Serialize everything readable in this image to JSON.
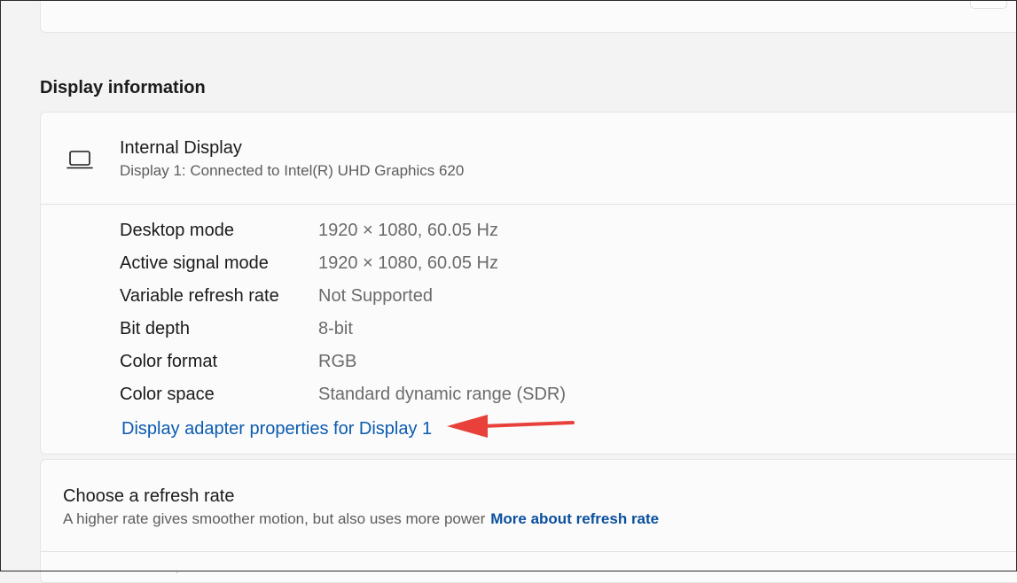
{
  "section": {
    "title": "Display information"
  },
  "display": {
    "icon": "laptop-icon",
    "name": "Internal Display",
    "subtitle": "Display 1: Connected to Intel(R) UHD Graphics 620",
    "info": [
      {
        "label": "Desktop mode",
        "value": "1920 × 1080, 60.05 Hz"
      },
      {
        "label": "Active signal mode",
        "value": "1920 × 1080, 60.05 Hz"
      },
      {
        "label": "Variable refresh rate",
        "value": "Not Supported"
      },
      {
        "label": "Bit depth",
        "value": "8-bit"
      },
      {
        "label": "Color format",
        "value": "RGB"
      },
      {
        "label": "Color space",
        "value": "Standard dynamic range (SDR)"
      }
    ],
    "adapter_link": "Display adapter properties for Display 1"
  },
  "refresh": {
    "title": "Choose a refresh rate",
    "description": "A higher rate gives smoother motion, but also uses more power",
    "link": "More about refresh rate"
  },
  "colors": {
    "accent_link": "#0a5bb0",
    "annotation_arrow": "#e8403a",
    "card_bg": "#fbfbfb",
    "page_bg": "#f3f3f3"
  }
}
